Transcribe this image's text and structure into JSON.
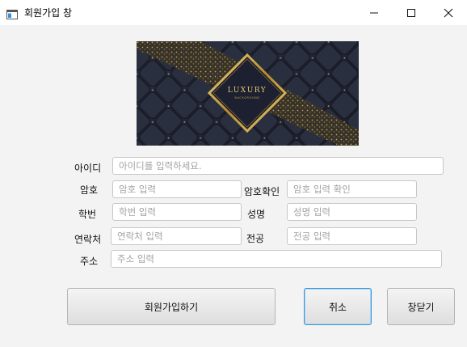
{
  "window": {
    "title": "회원가입 창",
    "icon": "app-window-icon",
    "controls": [
      "minimize-icon",
      "maximize-icon",
      "close-icon"
    ]
  },
  "banner": {
    "brand_text": "LUXURY",
    "sub_text": "BACKGROUND",
    "colors": {
      "dark": "#23283a",
      "gold": "#c9a24a"
    }
  },
  "form": {
    "id_label": "아이디",
    "id_placeholder": "아이디를 입력하세요.",
    "password_label": "암호",
    "password_placeholder": "암호 입력",
    "password_confirm_label": "암호확인",
    "password_confirm_placeholder": "암호 입력 확인",
    "student_id_label": "학번",
    "student_id_placeholder": "학번 입력",
    "name_label": "성명",
    "name_placeholder": "성명 입력",
    "contact_label": "연락처",
    "contact_placeholder": "연락처 입력",
    "major_label": "전공",
    "major_placeholder": "전공 입력",
    "address_label": "주소",
    "address_placeholder": "주소 입력"
  },
  "buttons": {
    "signup": "회원가입하기",
    "cancel": "취소",
    "close": "창닫기"
  }
}
